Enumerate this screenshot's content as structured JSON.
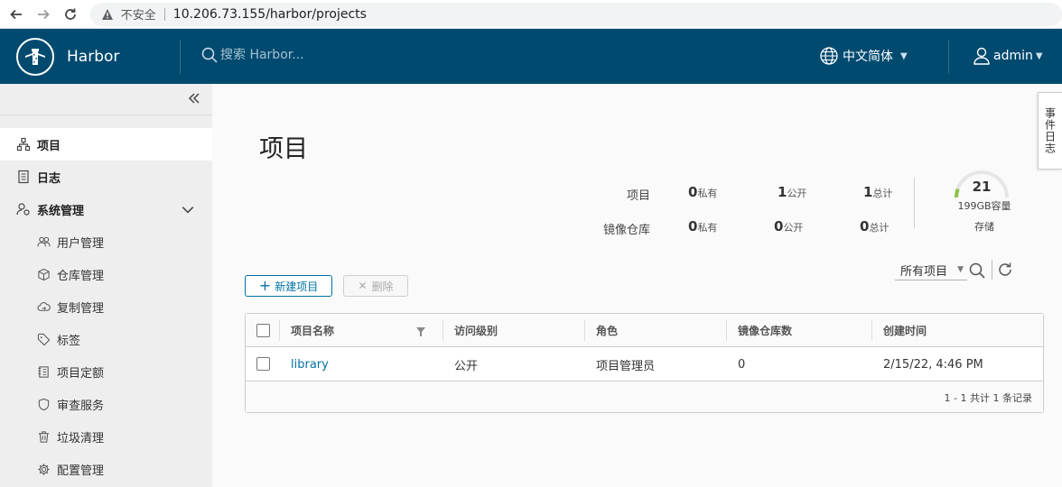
{
  "browser": {
    "insecure_label": "不安全",
    "url": "10.206.73.155/harbor/projects"
  },
  "header": {
    "brand": "Harbor",
    "search_placeholder": "搜索 Harbor...",
    "language": "中文简体",
    "user": "admin"
  },
  "sidebar": {
    "items": [
      {
        "label": "项目",
        "icon": "projects-icon",
        "active": true
      },
      {
        "label": "日志",
        "icon": "logs-icon"
      },
      {
        "label": "系统管理",
        "icon": "admin-icon",
        "expanded": true
      }
    ],
    "subitems": [
      {
        "label": "用户管理",
        "icon": "users-icon"
      },
      {
        "label": "仓库管理",
        "icon": "registry-icon"
      },
      {
        "label": "复制管理",
        "icon": "replication-icon"
      },
      {
        "label": "标签",
        "icon": "tag-icon"
      },
      {
        "label": "项目定额",
        "icon": "quota-icon"
      },
      {
        "label": "审查服务",
        "icon": "shield-icon"
      },
      {
        "label": "垃圾清理",
        "icon": "trash-icon"
      },
      {
        "label": "配置管理",
        "icon": "gear-icon"
      }
    ]
  },
  "main": {
    "title": "项目",
    "stats": {
      "projects_label": "项目",
      "repos_label": "镜像仓库",
      "private_unit": "私有",
      "public_unit": "公开",
      "total_unit": "总计",
      "projects": {
        "private": "0",
        "public": "1",
        "total": "1"
      },
      "repos": {
        "private": "0",
        "public": "0",
        "total": "0"
      }
    },
    "storage": {
      "used": "21",
      "capacity": "199GB容量",
      "label": "存储",
      "fraction": 0.11
    },
    "buttons": {
      "new_project": "新建项目",
      "delete": "删除"
    },
    "filter": {
      "selected": "所有项目"
    },
    "table": {
      "columns": [
        "项目名称",
        "访问级别",
        "角色",
        "镜像仓库数",
        "创建时间"
      ],
      "rows": [
        {
          "name": "library",
          "access": "公开",
          "role": "项目管理员",
          "repos": "0",
          "created": "2/15/22, 4:46 PM"
        }
      ],
      "footer": "1 - 1 共计 1 条记录"
    },
    "event_log": "事件日志"
  },
  "colors": {
    "header_bg": "#004a70",
    "accent": "#0072a3",
    "storage_green": "#8bc34a"
  }
}
